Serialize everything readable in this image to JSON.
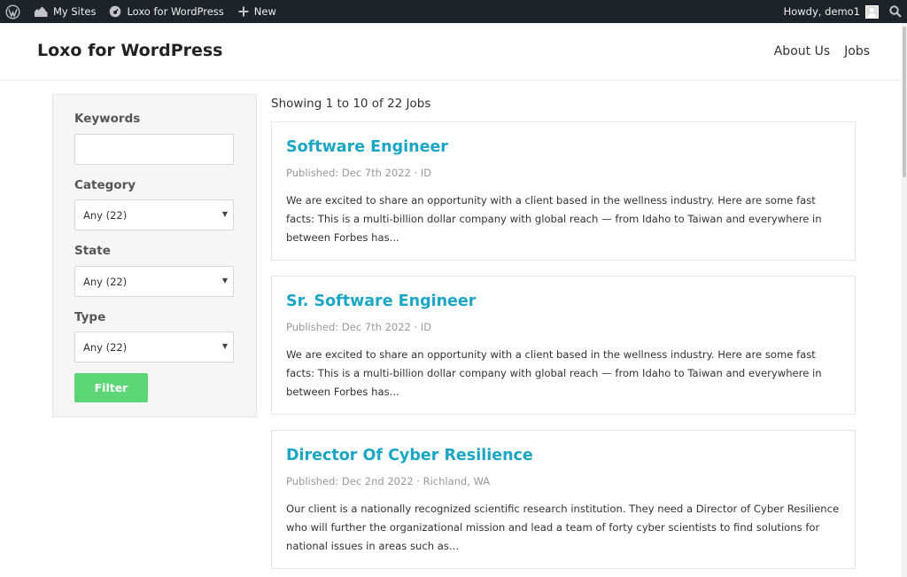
{
  "admin_bar": {
    "my_sites": "My Sites",
    "site_name": "Loxo for WordPress",
    "new_label": "New",
    "howdy": "Howdy, demo1"
  },
  "header": {
    "site_title": "Loxo for WordPress",
    "nav": [
      "About Us",
      "Jobs"
    ]
  },
  "filters": {
    "keywords_label": "Keywords",
    "keywords_value": "",
    "category_label": "Category",
    "category_value": "Any (22)",
    "state_label": "State",
    "state_value": "Any (22)",
    "type_label": "Type",
    "type_value": "Any (22)",
    "filter_button": "Filter"
  },
  "results": {
    "showing": "Showing 1 to 10 of 22 Jobs",
    "jobs": [
      {
        "title": "Software Engineer",
        "meta": "Published: Dec 7th 2022 · ID",
        "excerpt": "We are excited to share an opportunity with a client based in the wellness industry. Here are some fast facts: This is a multi-billion dollar company with global reach — from Idaho to Taiwan and everywhere in between Forbes has..."
      },
      {
        "title": "Sr. Software Engineer",
        "meta": "Published: Dec 7th 2022 · ID",
        "excerpt": "We are excited to share an opportunity with a client based in the wellness industry. Here are some fast facts: This is a multi-billion dollar company with global reach — from Idaho to Taiwan and everywhere in between Forbes has..."
      },
      {
        "title": "Director Of Cyber Resilience",
        "meta": "Published: Dec 2nd 2022 · Richland, WA",
        "excerpt": "Our client is a nationally recognized scientific research institution. They need a Director of Cyber Resilience who will further the organizational mission and lead a team of forty cyber scientists to find solutions for national issues in areas such as..."
      }
    ]
  },
  "colors": {
    "admin_bar_bg": "#1d2327",
    "job_title": "#1aa6c4",
    "filter_button_bg": "#5cd676"
  },
  "icons": [
    "wordpress-logo-icon",
    "my-sites-icon",
    "site-dashboard-icon",
    "plus-icon",
    "avatar-icon",
    "search-icon",
    "dropdown-arrow-icon"
  ]
}
